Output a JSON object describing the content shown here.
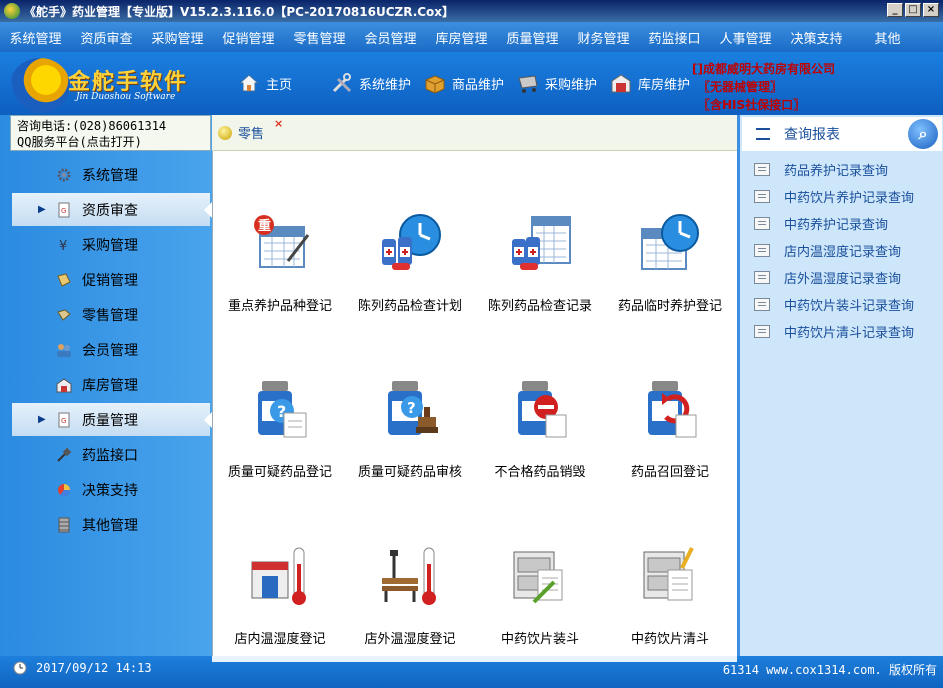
{
  "window": {
    "title": "《舵手》药业管理【专业版】V15.2.3.116.0【PC-20170816UCZR.Cox】"
  },
  "menu": [
    "系统管理",
    "资质审查",
    "采购管理",
    "促销管理",
    "零售管理",
    "会员管理",
    "库房管理",
    "质量管理",
    "财务管理",
    "药监接口",
    "人事管理",
    "决策支持",
    "其他"
  ],
  "logo": {
    "text": "金舵手软件",
    "sub": "Jin Duoshou Software"
  },
  "toolbar": [
    {
      "label": "主页",
      "icon": "home-icon"
    },
    {
      "label": "系统维护",
      "icon": "tools-icon"
    },
    {
      "label": "商品维护",
      "icon": "box-icon"
    },
    {
      "label": "采购维护",
      "icon": "cart-icon"
    },
    {
      "label": "库房维护",
      "icon": "warehouse-icon"
    }
  ],
  "company": [
    "[]成都威明大药房有限公司",
    "〖无器械管理〗",
    "〖含HIS社保接口〗"
  ],
  "contact": {
    "phone": "咨询电话:(028)86061314",
    "qq": "QQ服务平台(点击打开)"
  },
  "sidebar": [
    {
      "label": "系统管理",
      "icon": "gear-icon",
      "active": false
    },
    {
      "label": "资质审查",
      "icon": "document-icon",
      "active": true
    },
    {
      "label": "采购管理",
      "icon": "yen-icon",
      "active": false
    },
    {
      "label": "促销管理",
      "icon": "tag-icon",
      "active": false
    },
    {
      "label": "零售管理",
      "icon": "retail-icon",
      "active": false
    },
    {
      "label": "会员管理",
      "icon": "members-icon",
      "active": false
    },
    {
      "label": "库房管理",
      "icon": "warehouse-icon",
      "active": false
    },
    {
      "label": "质量管理",
      "icon": "document-icon",
      "active": true
    },
    {
      "label": "药监接口",
      "icon": "plug-icon",
      "active": false
    },
    {
      "label": "决策支持",
      "icon": "chart-icon",
      "active": false
    },
    {
      "label": "其他管理",
      "icon": "cabinet-icon",
      "active": false
    }
  ],
  "tab": {
    "label": "零售",
    "close": "×"
  },
  "tiles": [
    {
      "label": "重点养护品种登记",
      "icon": "calendar-pen-icon"
    },
    {
      "label": "陈列药品检查计划",
      "icon": "medicine-clock-icon"
    },
    {
      "label": "陈列药品检查记录",
      "icon": "medicine-calendar-icon"
    },
    {
      "label": "药品临时养护登记",
      "icon": "calendar-clock-icon"
    },
    {
      "label": "质量可疑药品登记",
      "icon": "bottle-question-icon"
    },
    {
      "label": "质量可疑药品审核",
      "icon": "bottle-stamp-icon"
    },
    {
      "label": "不合格药品销毁",
      "icon": "bottle-forbidden-icon"
    },
    {
      "label": "药品召回登记",
      "icon": "bottle-recall-icon"
    },
    {
      "label": "店内温湿度登记",
      "icon": "store-thermometer-icon"
    },
    {
      "label": "店外温湿度登记",
      "icon": "bench-thermometer-icon"
    },
    {
      "label": "中药饮片装斗",
      "icon": "drawer-pen-icon"
    },
    {
      "label": "中药饮片清斗",
      "icon": "drawer-clear-icon"
    }
  ],
  "query_panel": {
    "title": "查询报表",
    "items": [
      "药品养护记录查询",
      "中药饮片养护记录查询",
      "中药养护记录查询",
      "店内温湿度记录查询",
      "店外温湿度记录查询",
      "中药饮片装斗记录查询",
      "中药饮片清斗记录查询"
    ]
  },
  "status": {
    "datetime": "2017/09/12 14:13",
    "right": "61314 www.cox1314.com. 版权所有"
  }
}
